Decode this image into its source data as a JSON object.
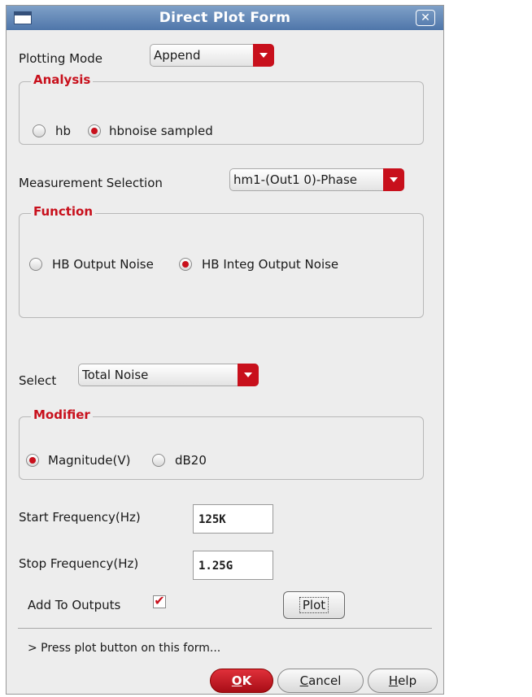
{
  "window": {
    "title": "Direct Plot Form",
    "close_symbol": "✕"
  },
  "plotting_mode": {
    "label": "Plotting Mode",
    "value": "Append"
  },
  "analysis": {
    "legend": "Analysis",
    "options": [
      {
        "label": "hb",
        "selected": false
      },
      {
        "label": "hbnoise sampled",
        "selected": true
      }
    ]
  },
  "measurement": {
    "label": "Measurement Selection",
    "value": "hm1-(Out1 0)-Phase"
  },
  "function": {
    "legend": "Function",
    "options": [
      {
        "label": "HB Output Noise",
        "selected": false
      },
      {
        "label": "HB Integ Output Noise",
        "selected": true
      }
    ]
  },
  "select": {
    "label": "Select",
    "value": "Total Noise"
  },
  "modifier": {
    "legend": "Modifier",
    "options": [
      {
        "label": "Magnitude(V)",
        "selected": true
      },
      {
        "label": "dB20",
        "selected": false
      }
    ]
  },
  "start_frequency": {
    "label": "Start Frequency(Hz)",
    "value": "125K"
  },
  "stop_frequency": {
    "label": "Stop Frequency(Hz)",
    "value": "1.25G"
  },
  "add_to_outputs": {
    "label": "Add To Outputs",
    "checked": true,
    "check_symbol": "✔"
  },
  "plot_button": {
    "label": "Plot"
  },
  "status": {
    "text": "> Press plot button on this form..."
  },
  "buttons": {
    "ok": {
      "mnemonic": "O",
      "rest": "K"
    },
    "cancel": {
      "mnemonic": "C",
      "rest": "ancel"
    },
    "help": {
      "mnemonic": "H",
      "rest": "elp"
    }
  },
  "colors": {
    "accent": "#c8101c",
    "titlebar": "#5a80b2",
    "window_bg": "#ededed"
  }
}
